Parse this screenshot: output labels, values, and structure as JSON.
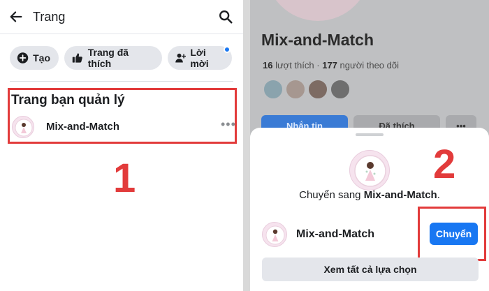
{
  "left": {
    "topbar": {
      "title": "Trang",
      "back_icon": "arrow-left-icon",
      "search_icon": "search-icon"
    },
    "chips": [
      {
        "label": "Tạo",
        "icon": "plus-circle-icon"
      },
      {
        "label": "Trang đã thích",
        "icon": "thumbs-up-icon"
      },
      {
        "label": "Lời mời",
        "icon": "person-add-icon"
      }
    ],
    "section_title": "Trang bạn quản lý",
    "managed_page": {
      "name": "Mix-and-Match",
      "more": "•••"
    },
    "step_label": "1"
  },
  "right": {
    "profile": {
      "name": "Mix-and-Match",
      "likes_count": "16",
      "likes_label": "lượt thích",
      "followers_count": "177",
      "followers_label": "người theo dõi",
      "separator": "·"
    },
    "buttons": {
      "message": "Nhắn tin",
      "liked": "Đã thích",
      "more": "•••"
    },
    "sheet": {
      "switch_prefix": "Chuyển sang ",
      "switch_page": "Mix-and-Match",
      "switch_suffix": ".",
      "row_name": "Mix-and-Match",
      "switch_button": "Chuyển",
      "see_all": "Xem tất cả lựa chọn"
    },
    "step_label": "2"
  },
  "colors": {
    "accent": "#1877f2",
    "annotation_red": "#e23b3b",
    "chip_bg": "#e4e6eb",
    "dim_overlay": "#bfc0c2"
  }
}
